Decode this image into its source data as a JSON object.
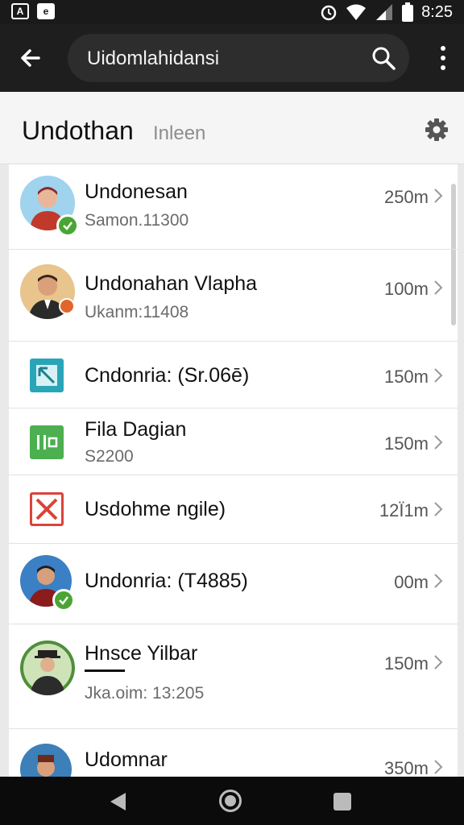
{
  "status_bar": {
    "left_icons": [
      "A",
      "e"
    ],
    "time": "8:25",
    "icons": [
      "alarm-icon",
      "wifi-icon",
      "signal-icon",
      "battery-icon"
    ]
  },
  "app_bar": {
    "search_value": "Uidomlahidansi",
    "icons": [
      "back-arrow-icon",
      "search-icon",
      "more-vert-icon"
    ]
  },
  "title_bar": {
    "title": "Undothan",
    "subtitle": "Inleen",
    "icon": "gear-icon"
  },
  "list": {
    "items": [
      {
        "name": "Undonesan",
        "sub": "Samon.11300",
        "dist": "250m",
        "icon": "avatar-person-icon",
        "verified": true
      },
      {
        "name": "Undonahan Vlapha",
        "sub": "Ukanm:11408",
        "dist": "100m",
        "icon": "avatar-person-icon",
        "verified": false
      },
      {
        "name": "Cndonria: (Sr.06ē)",
        "sub": "",
        "dist": "150m",
        "icon": "teal-square-icon",
        "verified": false
      },
      {
        "name": "Fila Dagian",
        "sub": "S2200",
        "dist": "150m",
        "icon": "green-square-icon",
        "verified": false
      },
      {
        "name": "Usdohme ngile)",
        "sub": "",
        "dist": "12Ї1m",
        "icon": "red-x-square-icon",
        "verified": false
      },
      {
        "name": "Undonria: (T4885)",
        "sub": "",
        "dist": "00m",
        "icon": "avatar-person-icon",
        "verified": true
      },
      {
        "name": "Hnsce Yilbar",
        "sub": "Jka.oim: 13:205",
        "dist": "150m",
        "icon": "avatar-person-icon",
        "verified": false
      },
      {
        "name": "Udomnar",
        "sub": "",
        "dist": "350m",
        "icon": "avatar-person-icon",
        "verified": false
      }
    ]
  },
  "nav_bar": {
    "icons": [
      "nav-back-icon",
      "nav-home-icon",
      "nav-recents-icon"
    ]
  },
  "colors": {
    "status_bar": "#1a1a1a",
    "app_bar": "#1e1e1e",
    "verified_badge": "#4aa534",
    "teal": "#2aa5b8",
    "green": "#4caf50",
    "red": "#d9443a"
  }
}
